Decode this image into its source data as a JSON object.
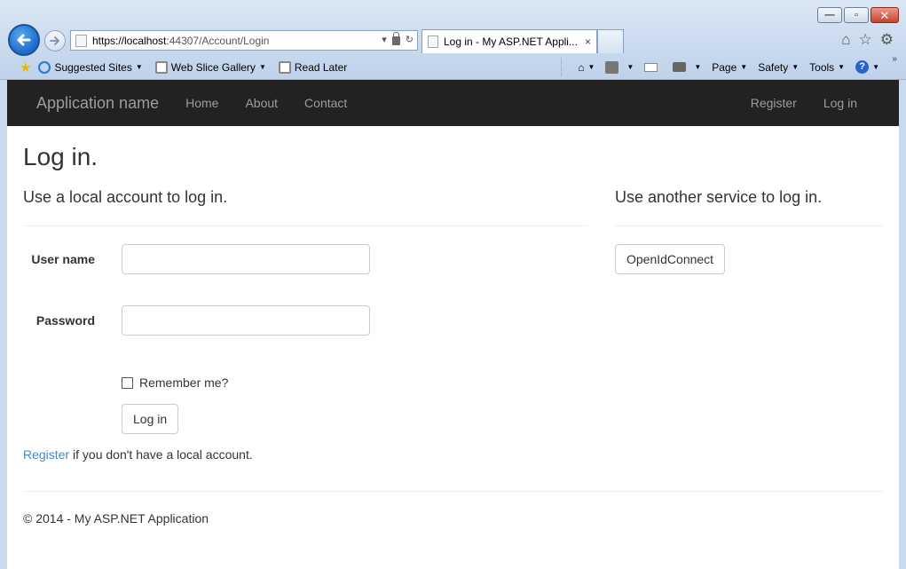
{
  "browser": {
    "address": {
      "url_dark": "https://localhost",
      "url_light": ":44307/Account/Login"
    },
    "tab": {
      "title": "Log in - My ASP.NET Appli...",
      "close": "×"
    },
    "window_buttons": {
      "minimize": "—",
      "maximize": "▫",
      "close": "✕"
    },
    "favorites": [
      {
        "label": "Suggested Sites"
      },
      {
        "label": "Web Slice Gallery"
      },
      {
        "label": "Read Later"
      }
    ],
    "commands": {
      "page": "Page",
      "safety": "Safety",
      "tools": "Tools"
    },
    "right_icons": {
      "home": "⌂",
      "favorites": "☆",
      "settings": "⚙"
    }
  },
  "navbar": {
    "brand": "Application name",
    "links": [
      "Home",
      "About",
      "Contact"
    ],
    "right_links": [
      "Register",
      "Log in"
    ]
  },
  "page": {
    "title": "Log in.",
    "local_heading": "Use a local account to log in.",
    "external_heading": "Use another service to log in.",
    "username_label": "User name",
    "password_label": "Password",
    "username_value": "",
    "password_value": "",
    "remember_label": "Remember me?",
    "login_button": "Log in",
    "openid_button": "OpenIdConnect",
    "register_link": "Register",
    "register_suffix": " if you don't have a local account.",
    "footer": "© 2014 - My ASP.NET Application"
  },
  "colors": {
    "navbar_bg": "#222222",
    "navbar_text": "#9d9d9d",
    "link": "#428bca"
  }
}
